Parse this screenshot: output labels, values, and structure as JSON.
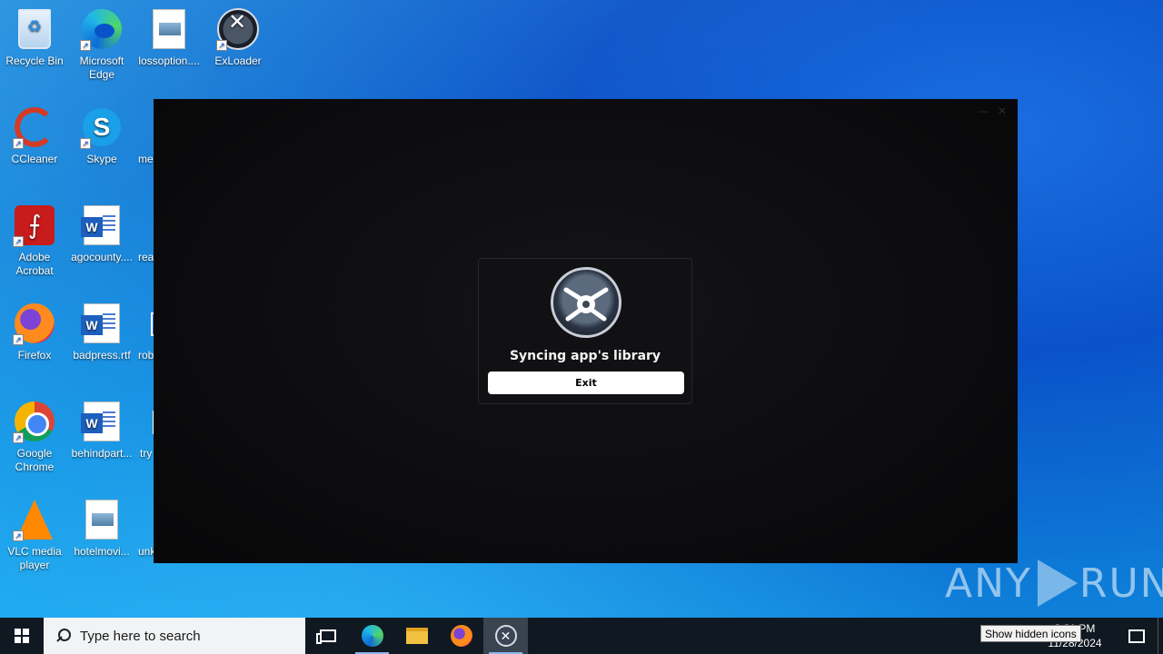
{
  "desktop": {
    "icons": [
      {
        "label": "Recycle Bin",
        "icon": "recycle-bin-icon"
      },
      {
        "label": "Microsoft\nEdge",
        "icon": "edge-icon"
      },
      {
        "label": "lossoption....",
        "icon": "image-file-icon"
      },
      {
        "label": "ExLoader",
        "icon": "exloader-icon"
      },
      {
        "label": "CCleaner",
        "icon": "ccleaner-icon"
      },
      {
        "label": "Skype",
        "icon": "skype-icon"
      },
      {
        "label": "me",
        "icon": "file-icon"
      },
      {
        "label": "Adobe\nAcrobat",
        "icon": "acrobat-icon"
      },
      {
        "label": "agocounty....",
        "icon": "word-doc-icon"
      },
      {
        "label": "rea",
        "icon": "file-icon"
      },
      {
        "label": "Firefox",
        "icon": "firefox-icon"
      },
      {
        "label": "badpress.rtf",
        "icon": "word-doc-icon"
      },
      {
        "label": "rob",
        "icon": "file-icon"
      },
      {
        "label": "Google\nChrome",
        "icon": "chrome-icon"
      },
      {
        "label": "behindpart...",
        "icon": "word-doc-icon"
      },
      {
        "label": "try",
        "icon": "file-icon"
      },
      {
        "label": "VLC media\nplayer",
        "icon": "vlc-icon"
      },
      {
        "label": "hotelmovi...",
        "icon": "image-file-icon"
      },
      {
        "label": "unk",
        "icon": "file-icon"
      }
    ]
  },
  "app_window": {
    "dialog": {
      "title": "Syncing app's library",
      "exit_label": "Exit"
    }
  },
  "watermark": {
    "left": "ANY",
    "right": "RUN"
  },
  "taskbar": {
    "search_placeholder": "Type here to search",
    "clock_time": "3:21 PM",
    "clock_date": "11/28/2024",
    "tooltip": "Show hidden icons"
  }
}
